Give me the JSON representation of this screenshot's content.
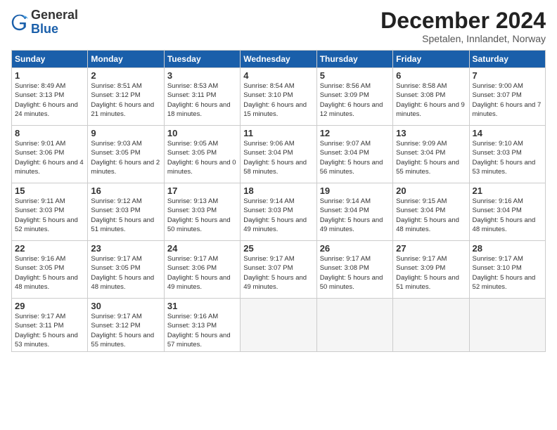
{
  "logo": {
    "general": "General",
    "blue": "Blue"
  },
  "header": {
    "month": "December 2024",
    "location": "Spetalen, Innlandet, Norway"
  },
  "weekdays": [
    "Sunday",
    "Monday",
    "Tuesday",
    "Wednesday",
    "Thursday",
    "Friday",
    "Saturday"
  ],
  "weeks": [
    [
      {
        "day": "1",
        "sunrise": "8:49 AM",
        "sunset": "3:13 PM",
        "daylight": "6 hours and 24 minutes."
      },
      {
        "day": "2",
        "sunrise": "8:51 AM",
        "sunset": "3:12 PM",
        "daylight": "6 hours and 21 minutes."
      },
      {
        "day": "3",
        "sunrise": "8:53 AM",
        "sunset": "3:11 PM",
        "daylight": "6 hours and 18 minutes."
      },
      {
        "day": "4",
        "sunrise": "8:54 AM",
        "sunset": "3:10 PM",
        "daylight": "6 hours and 15 minutes."
      },
      {
        "day": "5",
        "sunrise": "8:56 AM",
        "sunset": "3:09 PM",
        "daylight": "6 hours and 12 minutes."
      },
      {
        "day": "6",
        "sunrise": "8:58 AM",
        "sunset": "3:08 PM",
        "daylight": "6 hours and 9 minutes."
      },
      {
        "day": "7",
        "sunrise": "9:00 AM",
        "sunset": "3:07 PM",
        "daylight": "6 hours and 7 minutes."
      }
    ],
    [
      {
        "day": "8",
        "sunrise": "9:01 AM",
        "sunset": "3:06 PM",
        "daylight": "6 hours and 4 minutes."
      },
      {
        "day": "9",
        "sunrise": "9:03 AM",
        "sunset": "3:05 PM",
        "daylight": "6 hours and 2 minutes."
      },
      {
        "day": "10",
        "sunrise": "9:05 AM",
        "sunset": "3:05 PM",
        "daylight": "6 hours and 0 minutes."
      },
      {
        "day": "11",
        "sunrise": "9:06 AM",
        "sunset": "3:04 PM",
        "daylight": "5 hours and 58 minutes."
      },
      {
        "day": "12",
        "sunrise": "9:07 AM",
        "sunset": "3:04 PM",
        "daylight": "5 hours and 56 minutes."
      },
      {
        "day": "13",
        "sunrise": "9:09 AM",
        "sunset": "3:04 PM",
        "daylight": "5 hours and 55 minutes."
      },
      {
        "day": "14",
        "sunrise": "9:10 AM",
        "sunset": "3:03 PM",
        "daylight": "5 hours and 53 minutes."
      }
    ],
    [
      {
        "day": "15",
        "sunrise": "9:11 AM",
        "sunset": "3:03 PM",
        "daylight": "5 hours and 52 minutes."
      },
      {
        "day": "16",
        "sunrise": "9:12 AM",
        "sunset": "3:03 PM",
        "daylight": "5 hours and 51 minutes."
      },
      {
        "day": "17",
        "sunrise": "9:13 AM",
        "sunset": "3:03 PM",
        "daylight": "5 hours and 50 minutes."
      },
      {
        "day": "18",
        "sunrise": "9:14 AM",
        "sunset": "3:03 PM",
        "daylight": "5 hours and 49 minutes."
      },
      {
        "day": "19",
        "sunrise": "9:14 AM",
        "sunset": "3:04 PM",
        "daylight": "5 hours and 49 minutes."
      },
      {
        "day": "20",
        "sunrise": "9:15 AM",
        "sunset": "3:04 PM",
        "daylight": "5 hours and 48 minutes."
      },
      {
        "day": "21",
        "sunrise": "9:16 AM",
        "sunset": "3:04 PM",
        "daylight": "5 hours and 48 minutes."
      }
    ],
    [
      {
        "day": "22",
        "sunrise": "9:16 AM",
        "sunset": "3:05 PM",
        "daylight": "5 hours and 48 minutes."
      },
      {
        "day": "23",
        "sunrise": "9:17 AM",
        "sunset": "3:05 PM",
        "daylight": "5 hours and 48 minutes."
      },
      {
        "day": "24",
        "sunrise": "9:17 AM",
        "sunset": "3:06 PM",
        "daylight": "5 hours and 49 minutes."
      },
      {
        "day": "25",
        "sunrise": "9:17 AM",
        "sunset": "3:07 PM",
        "daylight": "5 hours and 49 minutes."
      },
      {
        "day": "26",
        "sunrise": "9:17 AM",
        "sunset": "3:08 PM",
        "daylight": "5 hours and 50 minutes."
      },
      {
        "day": "27",
        "sunrise": "9:17 AM",
        "sunset": "3:09 PM",
        "daylight": "5 hours and 51 minutes."
      },
      {
        "day": "28",
        "sunrise": "9:17 AM",
        "sunset": "3:10 PM",
        "daylight": "5 hours and 52 minutes."
      }
    ],
    [
      {
        "day": "29",
        "sunrise": "9:17 AM",
        "sunset": "3:11 PM",
        "daylight": "5 hours and 53 minutes."
      },
      {
        "day": "30",
        "sunrise": "9:17 AM",
        "sunset": "3:12 PM",
        "daylight": "5 hours and 55 minutes."
      },
      {
        "day": "31",
        "sunrise": "9:16 AM",
        "sunset": "3:13 PM",
        "daylight": "5 hours and 57 minutes."
      },
      null,
      null,
      null,
      null
    ]
  ]
}
